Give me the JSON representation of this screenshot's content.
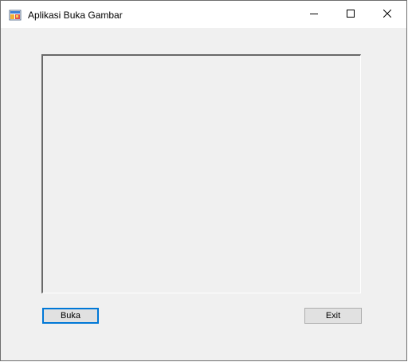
{
  "window": {
    "title": "Aplikasi Buka Gambar",
    "icon": "form-app-icon"
  },
  "controls": {
    "minimize_icon": "minimize-icon",
    "maximize_icon": "maximize-icon",
    "close_icon": "close-icon"
  },
  "picture_box": {
    "image": ""
  },
  "buttons": {
    "buka_label": "Buka",
    "exit_label": "Exit"
  },
  "colors": {
    "focus_border": "#0078d7",
    "button_face": "#e1e1e1",
    "form_background": "#f0f0f0"
  }
}
